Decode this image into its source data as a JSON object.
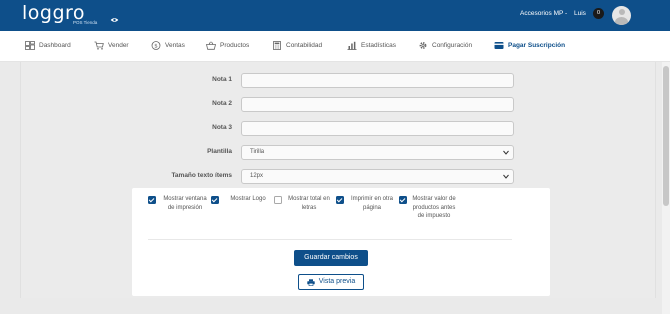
{
  "header": {
    "logo_text": "loggro",
    "logo_sub": "POS Tienda",
    "account_label": "Accesorios MP -",
    "user_label": "Luis",
    "badge_count": "0",
    "colors": {
      "primary": "#0e4f8a"
    }
  },
  "nav": {
    "items": [
      {
        "label": "Dashboard",
        "icon": "dashboard-icon"
      },
      {
        "label": "Vender",
        "icon": "cart-icon"
      },
      {
        "label": "Ventas",
        "icon": "dollar-circle-icon"
      },
      {
        "label": "Productos",
        "icon": "basket-icon"
      },
      {
        "label": "Contabilidad",
        "icon": "calculator-icon"
      },
      {
        "label": "Estadísticas",
        "icon": "bar-chart-icon"
      },
      {
        "label": "Configuración",
        "icon": "gear-icon"
      },
      {
        "label": "Pagar Suscripción",
        "icon": "credit-card-icon",
        "active": true
      }
    ]
  },
  "form": {
    "nota1_label": "Nota 1",
    "nota2_label": "Nota 2",
    "nota3_label": "Nota 3",
    "plantilla_label": "Plantilla",
    "plantilla_value": "Tirilla",
    "tamano_label": "Tamaño texto ítems",
    "tamano_value": "12px"
  },
  "modal": {
    "options": [
      {
        "label": "Mostrar ventana de impresión",
        "checked": true
      },
      {
        "label": "Mostrar Logo",
        "checked": true
      },
      {
        "label": "Mostrar total en letras",
        "checked": false
      },
      {
        "label": "Imprimir en otra página",
        "checked": true
      },
      {
        "label": "Mostrar valor de productos antes de impuesto",
        "checked": true
      }
    ],
    "save_label": "Guardar cambios",
    "preview_label": "Vista previa"
  }
}
